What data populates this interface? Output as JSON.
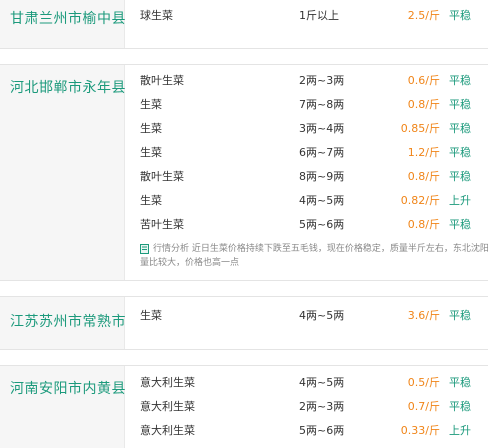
{
  "groups": [
    {
      "region": "甘肃兰州市榆中县",
      "rows": [
        {
          "name": "球生菜",
          "spec": "1斤以上",
          "price": "2.5/斤",
          "trend": "平稳"
        }
      ]
    },
    {
      "region": "河北邯郸市永年县",
      "rows": [
        {
          "name": "散叶生菜",
          "spec": "2两~3两",
          "price": "0.6/斤",
          "trend": "平稳"
        },
        {
          "name": "生菜",
          "spec": "7两~8两",
          "price": "0.8/斤",
          "trend": "平稳"
        },
        {
          "name": "生菜",
          "spec": "3两~4两",
          "price": "0.85/斤",
          "trend": "平稳"
        },
        {
          "name": "生菜",
          "spec": "6两~7两",
          "price": "1.2/斤",
          "trend": "平稳"
        },
        {
          "name": "散叶生菜",
          "spec": "8两~9两",
          "price": "0.8/斤",
          "trend": "平稳"
        },
        {
          "name": "生菜",
          "spec": "4两~5两",
          "price": "0.82/斤",
          "trend": "上升"
        },
        {
          "name": "苦叶生菜",
          "spec": "5两~6两",
          "price": "0.8/斤",
          "trend": "平稳"
        }
      ],
      "analysis_line1": "行情分析 近日生菜价格持续下跌至五毛钱，现在价格稳定，质量半斤左右，东北沈阳，哈尔",
      "analysis_line2": "量比较大，价格也高一点"
    },
    {
      "region": "江苏苏州市常熟市",
      "rows": [
        {
          "name": "生菜",
          "spec": "4两~5两",
          "price": "3.6/斤",
          "trend": "平稳"
        }
      ]
    },
    {
      "region": "河南安阳市内黄县",
      "rows": [
        {
          "name": "意大利生菜",
          "spec": "4两~5两",
          "price": "0.5/斤",
          "trend": "平稳"
        },
        {
          "name": "意大利生菜",
          "spec": "2两~3两",
          "price": "0.7/斤",
          "trend": "平稳"
        },
        {
          "name": "意大利生菜",
          "spec": "5两~6两",
          "price": "0.33/斤",
          "trend": "上升"
        }
      ]
    }
  ],
  "colors": {
    "region_text": "#1c9a7c",
    "price_text": "#f08519",
    "trend_text": "#1c9a7c",
    "region_bg": "#f6f6f6"
  }
}
